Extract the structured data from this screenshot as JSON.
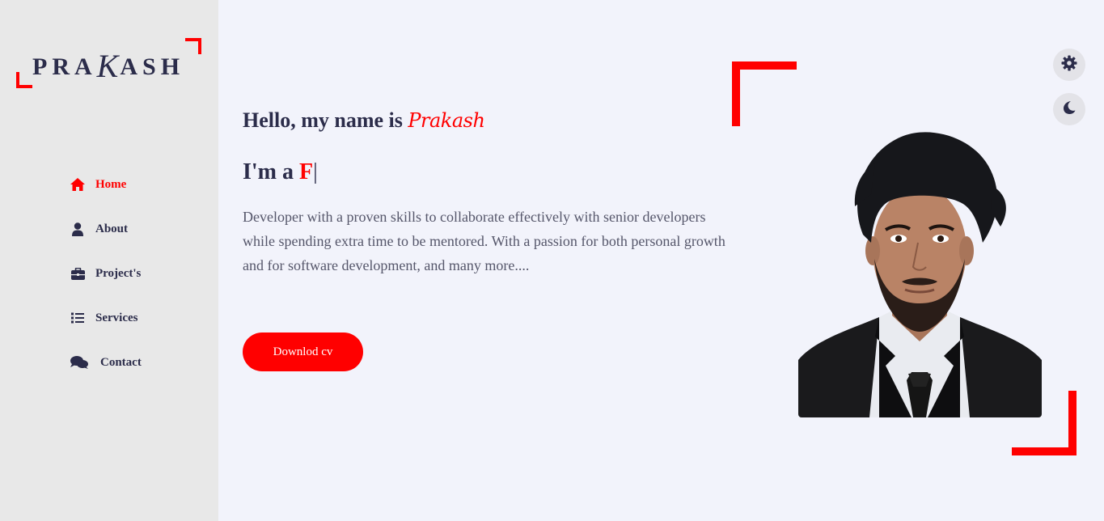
{
  "logo": {
    "text_before": "PRA",
    "text_k": "K",
    "text_after": "ASH"
  },
  "nav": {
    "items": [
      {
        "label": "Home",
        "icon": "home-icon",
        "active": true
      },
      {
        "label": "About",
        "icon": "user-icon",
        "active": false
      },
      {
        "label": "Project's",
        "icon": "briefcase-icon",
        "active": false
      },
      {
        "label": "Services",
        "icon": "list-icon",
        "active": false
      },
      {
        "label": "Contact",
        "icon": "chat-icon",
        "active": false
      }
    ]
  },
  "hero": {
    "greeting": "Hello, my name is",
    "name": "Prakash",
    "role_prefix": "I'm a",
    "role_typed": "F",
    "cursor": "|",
    "description": "Developer with a proven skills to collaborate effectively with senior developers while spending extra time to be mentored. With a passion for both personal growth and for software development, and many more....",
    "cv_button": "Downlod cv"
  },
  "controls": {
    "settings_icon": "gear-icon",
    "theme_icon": "moon-icon"
  },
  "colors": {
    "accent": "#ff0000",
    "text": "#2b2c4a",
    "sidebar": "#e8e8e8",
    "background": "#f2f3fb"
  }
}
